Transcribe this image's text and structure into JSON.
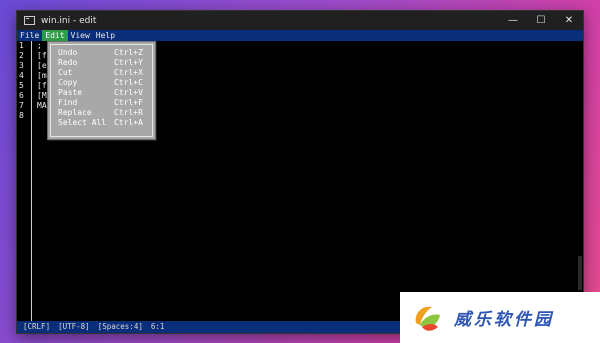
{
  "window": {
    "title": "win.ini - edit",
    "controls": {
      "minimize": "—",
      "maximize": "☐",
      "close": "✕"
    }
  },
  "menubar": [
    {
      "label": "File",
      "active": false
    },
    {
      "label": "Edit",
      "active": true
    },
    {
      "label": "View",
      "active": false
    },
    {
      "label": "Help",
      "active": false
    }
  ],
  "editor": {
    "line_numbers": [
      "1",
      "2",
      "3",
      "4",
      "5",
      "6",
      "7",
      "8"
    ],
    "lines": [
      ";",
      "[f",
      "[e",
      "[m",
      "[f",
      "[M",
      "MA",
      ""
    ]
  },
  "edit_menu": [
    {
      "label": "Undo",
      "shortcut": "Ctrl+Z"
    },
    {
      "label": "Redo",
      "shortcut": "Ctrl+Y"
    },
    {
      "label": "Cut",
      "shortcut": "Ctrl+X"
    },
    {
      "label": "Copy",
      "shortcut": "Ctrl+C"
    },
    {
      "label": "Paste",
      "shortcut": "Ctrl+V"
    },
    {
      "label": "Find",
      "shortcut": "Ctrl+F"
    },
    {
      "label": "Replace",
      "shortcut": "Ctrl+R"
    },
    {
      "label": "Select All",
      "shortcut": "Ctrl+A"
    }
  ],
  "statusbar": {
    "line_ending": "[CRLF]",
    "encoding": "[UTF-8]",
    "indent": "[Spaces:4]",
    "position": "6:1"
  },
  "watermark": {
    "text": "威乐软件园"
  },
  "colors": {
    "menubar_bg": "#0b2e7a",
    "menu_active": "#2d9c47",
    "dropdown_bg": "#a8a8a8",
    "editor_bg": "#000000"
  }
}
